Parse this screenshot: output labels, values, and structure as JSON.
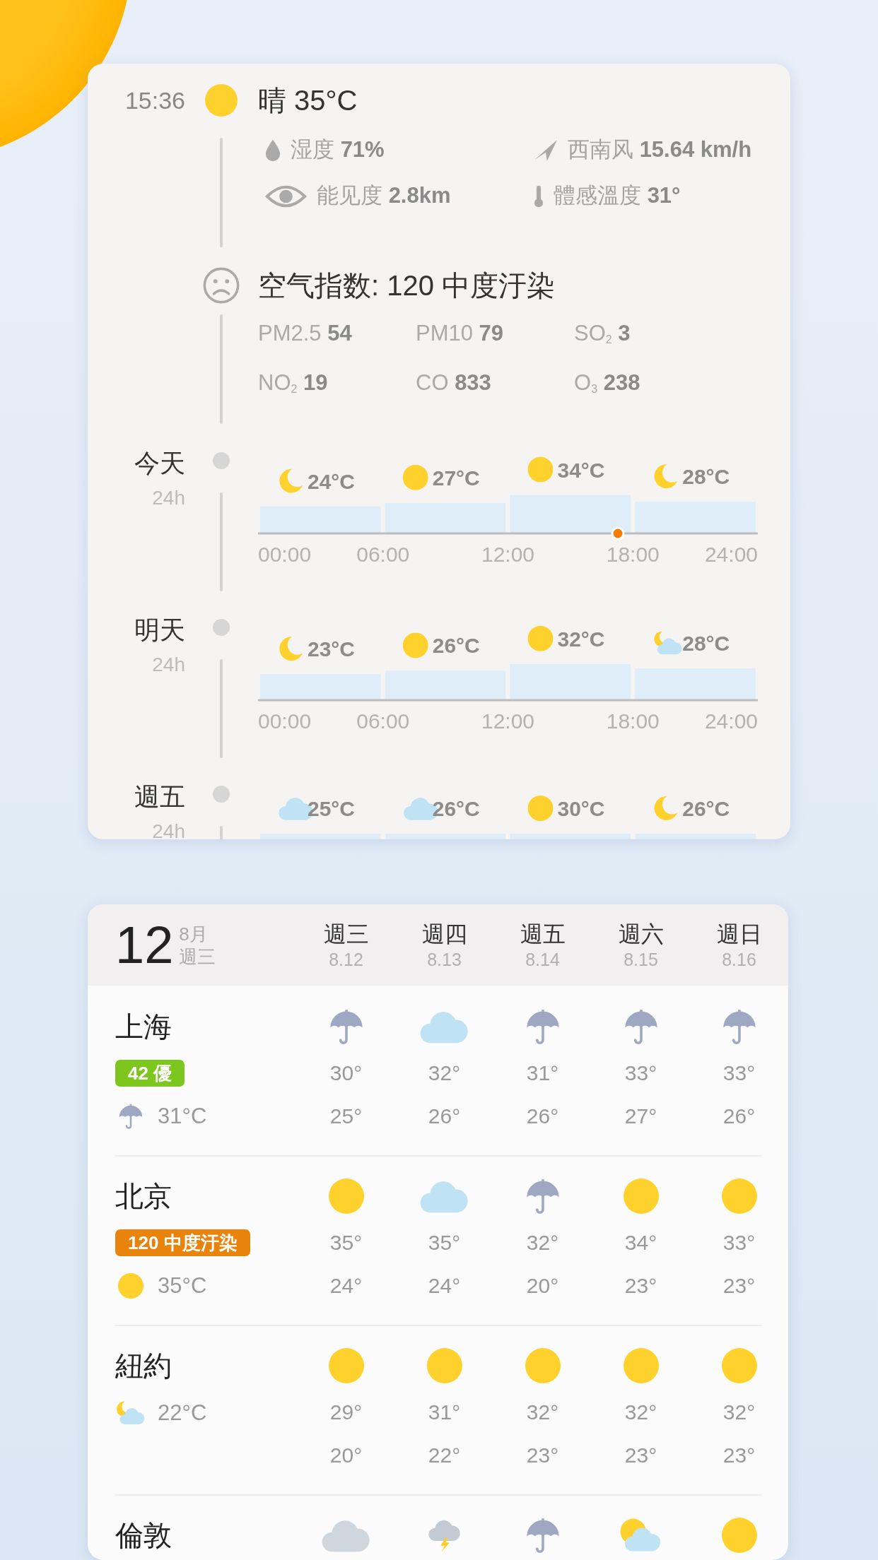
{
  "current": {
    "time": "15:36",
    "kind": "sun",
    "condition": "晴 35°C",
    "details": [
      {
        "kind": "drop",
        "text": "湿度 **71%**"
      },
      {
        "kind": "wind",
        "text": "西南风 **15.64 km/h**"
      },
      {
        "kind": "eye",
        "text": "能见度 **2.8km**"
      },
      {
        "kind": "thermometer",
        "text": "體感溫度 **31°**"
      }
    ]
  },
  "air_quality": {
    "kind": "sad",
    "text": "空气指数: 120 中度汙染",
    "pollutants": [
      {
        "text": "PM2.5 **54**"
      },
      {
        "text": "PM10 **79**"
      },
      {
        "text": "SO$_{2}$ **3**"
      },
      {
        "text": "NO$_{2}$ **19**"
      },
      {
        "text": "CO **833**"
      },
      {
        "text": "O$_{3}$ **238**"
      }
    ]
  },
  "days": [
    {
      "label": "今天",
      "span": "24h",
      "icons": [
        {
          "kind": "moon"
        },
        {
          "kind": "sun"
        },
        {
          "kind": "sun"
        },
        {
          "kind": "moon"
        }
      ],
      "now_marker": {
        "level": 0.72
      },
      "chart_data": {
        "type": "bar",
        "x": [
          3,
          9,
          15,
          21
        ],
        "values": [
          24,
          27,
          34,
          28
        ],
        "xlim": [
          0,
          24
        ],
        "value_labels": [
          "24°C",
          "27°C",
          "34°C",
          "28°C"
        ],
        "xticks": [
          {
            "value": 0,
            "label": "00:00"
          },
          {
            "value": 6,
            "label": "06:00"
          },
          {
            "value": 12,
            "label": "12:00"
          },
          {
            "value": 18,
            "label": "18:00"
          },
          {
            "value": 24,
            "label": "24:00"
          }
        ]
      }
    },
    {
      "label": "明天",
      "span": "24h",
      "icons": [
        {
          "kind": "moon"
        },
        {
          "kind": "sun"
        },
        {
          "kind": "sun"
        },
        {
          "kind": "moon-cloud"
        }
      ],
      "chart_data": {
        "type": "bar",
        "x": [
          3,
          9,
          15,
          21
        ],
        "values": [
          23,
          26,
          32,
          28
        ],
        "xlim": [
          0,
          24
        ],
        "value_labels": [
          "23°C",
          "26°C",
          "32°C",
          "28°C"
        ],
        "xticks": [
          {
            "value": 0,
            "label": "00:00"
          },
          {
            "value": 6,
            "label": "06:00"
          },
          {
            "value": 12,
            "label": "12:00"
          },
          {
            "value": 18,
            "label": "18:00"
          },
          {
            "value": 24,
            "label": "24:00"
          }
        ]
      }
    },
    {
      "label": "週五",
      "span": "24h",
      "periods": [
        {
          "kind": "cloud",
          "temp": "25°C"
        },
        {
          "kind": "cloud",
          "temp": "26°C"
        },
        {
          "kind": "sun",
          "temp": "30°C"
        },
        {
          "kind": "moon",
          "temp": "26°C"
        }
      ]
    }
  ],
  "forecast": {
    "date": "12",
    "month": "8月",
    "weekday": "週三",
    "columns": [
      {
        "day": "週三",
        "date": "8.12"
      },
      {
        "day": "週四",
        "date": "8.13"
      },
      {
        "day": "週五",
        "date": "8.14"
      },
      {
        "day": "週六",
        "date": "8.15"
      },
      {
        "day": "週日",
        "date": "8.16"
      }
    ],
    "cities": [
      {
        "name": "上海",
        "aqi": {
          "text": "42 優",
          "color": "#7cc61e"
        },
        "current": {
          "kind": "umbrella",
          "temp": "31°C"
        },
        "days": [
          {
            "kind": "umbrella",
            "high": "30°",
            "low": "25°"
          },
          {
            "kind": "cloud",
            "high": "32°",
            "low": "26°"
          },
          {
            "kind": "umbrella",
            "high": "31°",
            "low": "26°"
          },
          {
            "kind": "umbrella",
            "high": "33°",
            "low": "27°"
          },
          {
            "kind": "umbrella",
            "high": "33°",
            "low": "26°"
          }
        ]
      },
      {
        "name": "北京",
        "aqi": {
          "text": "120 中度汙染",
          "color": "#e8830c"
        },
        "current": {
          "kind": "sun",
          "temp": "35°C"
        },
        "days": [
          {
            "kind": "sun",
            "high": "35°",
            "low": "24°"
          },
          {
            "kind": "cloud",
            "high": "35°",
            "low": "24°"
          },
          {
            "kind": "umbrella",
            "high": "32°",
            "low": "20°"
          },
          {
            "kind": "sun",
            "high": "34°",
            "low": "23°"
          },
          {
            "kind": "sun",
            "high": "33°",
            "low": "23°"
          }
        ]
      },
      {
        "name": "紐約",
        "current": {
          "kind": "moon-cloud",
          "temp": "22°C"
        },
        "days": [
          {
            "kind": "sun",
            "high": "29°",
            "low": "20°"
          },
          {
            "kind": "sun",
            "high": "31°",
            "low": "22°"
          },
          {
            "kind": "sun",
            "high": "32°",
            "low": "23°"
          },
          {
            "kind": "sun",
            "high": "32°",
            "low": "23°"
          },
          {
            "kind": "sun",
            "high": "32°",
            "low": "23°"
          }
        ]
      },
      {
        "name": "倫敦",
        "days": [
          {
            "kind": "overcast"
          },
          {
            "kind": "thunder"
          },
          {
            "kind": "umbrella"
          },
          {
            "kind": "sun-cloud"
          },
          {
            "kind": "sun"
          }
        ]
      }
    ]
  }
}
